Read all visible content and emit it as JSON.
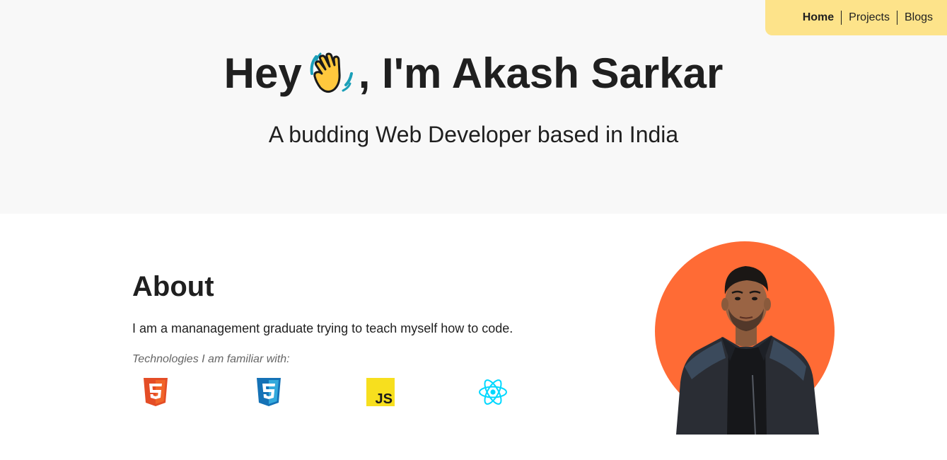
{
  "nav": {
    "items": [
      {
        "label": "Home",
        "active": true
      },
      {
        "label": "Projects",
        "active": false
      },
      {
        "label": "Blogs",
        "active": false
      }
    ],
    "background": "#fde38a"
  },
  "hero": {
    "greeting": "Hey",
    "intro": ", I'm Akash Sarkar",
    "emoji": "waving-hand-icon",
    "subtitle": "A budding Web Developer based in India",
    "background": "#f8f8f8"
  },
  "about": {
    "heading": "About",
    "description": "I am a mananagement graduate trying to teach myself how to code.",
    "tech_label": "Technologies I am familiar with:",
    "technologies": [
      {
        "name": "html5-icon",
        "color": "#e44d26"
      },
      {
        "name": "css3-icon",
        "color": "#1572b6"
      },
      {
        "name": "javascript-icon",
        "color": "#f7df1e"
      },
      {
        "name": "react-icon",
        "color": "#00d8ff"
      }
    ]
  },
  "portrait": {
    "icon": "profile-photo",
    "circle_color": "#ff6b35"
  }
}
